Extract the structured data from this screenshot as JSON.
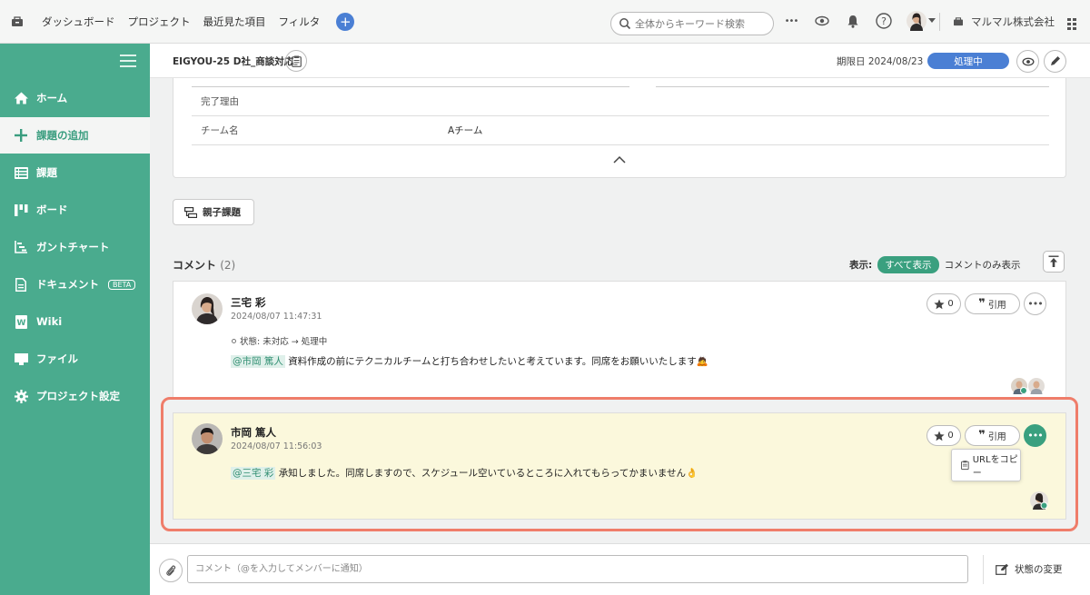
{
  "topbar": {
    "nav": [
      "ダッシュボード",
      "プロジェクト",
      "最近見た項目",
      "フィルタ"
    ],
    "search_placeholder": "全体からキーワード検索",
    "more_label": "•••",
    "company": "マルマル株式会社"
  },
  "sidebar": {
    "items": [
      {
        "label": "ホーム",
        "icon": "home-icon"
      },
      {
        "label": "課題の追加",
        "icon": "plus-icon"
      },
      {
        "label": "課題",
        "icon": "list-icon"
      },
      {
        "label": "ボード",
        "icon": "board-icon"
      },
      {
        "label": "ガントチャート",
        "icon": "gantt-icon"
      },
      {
        "label": "ドキュメント",
        "icon": "document-icon",
        "badge": "BETA"
      },
      {
        "label": "Wiki",
        "icon": "wiki-icon"
      },
      {
        "label": "ファイル",
        "icon": "folder-icon"
      },
      {
        "label": "プロジェクト設定",
        "icon": "gear-icon"
      }
    ],
    "active_index": 1
  },
  "issue": {
    "key_title": "EIGYOU-25  D社_商談対応",
    "due": "期限日 2024/08/23",
    "status": "処理中"
  },
  "details": {
    "rows": [
      {
        "label": "完了理由",
        "value": ""
      },
      {
        "label": "チーム名",
        "value": "Aチーム"
      }
    ]
  },
  "parent_issue_label": "親子課題",
  "comments_section": {
    "title": "コメント",
    "count": "(2)",
    "display_label": "表示:",
    "show_all": "すべて表示",
    "only_comments": "コメントのみ表示"
  },
  "comments": [
    {
      "name": "三宅 彩",
      "date": "2024/08/07 11:47:31",
      "status_change": "状態: 未対応 → 処理中",
      "mention": "@市岡 篤人",
      "body": "資料作成の前にテクニカルチームと打ち合わせしたいと考えています。同席をお願いいたします",
      "emoji": "🙇",
      "stars": "0",
      "quote_label": "引用"
    },
    {
      "name": "市岡 篤人",
      "date": "2024/08/07 11:56:03",
      "mention": "@三宅 彩",
      "body": "承知しました。同席しますので、スケジュール空いているところに入れてもらってかまいません",
      "emoji": "👌",
      "stars": "0",
      "quote_label": "引用"
    }
  ],
  "menu": {
    "copy_url": "URLをコピー"
  },
  "bottom": {
    "comment_placeholder": "コメント（@を入力してメンバーに通知）",
    "state_change": "状態の変更"
  },
  "colors": {
    "sidebar": "#4aab8e",
    "accent": "#3aa07f",
    "status": "#4a7fd4",
    "highlight": "#ef7d6a"
  }
}
